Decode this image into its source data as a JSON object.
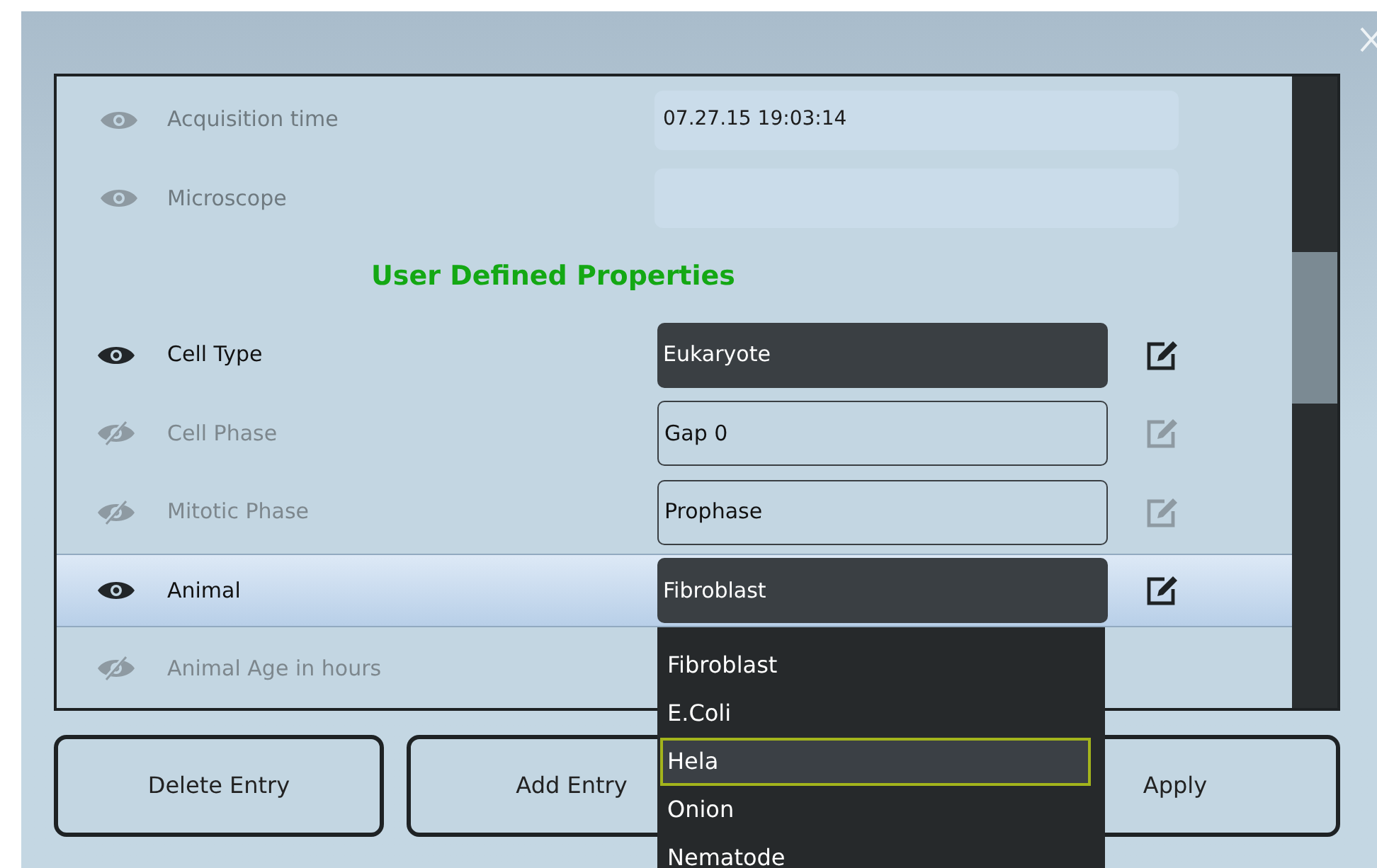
{
  "rows": [
    {
      "kind": "system",
      "label": "Acquisition time",
      "value": "07.27.15 19:03:14"
    },
    {
      "kind": "system",
      "label": "Microscope",
      "value": ""
    },
    {
      "kind": "header",
      "label": "User Defined Properties"
    },
    {
      "kind": "user",
      "label": "Cell Type",
      "value": "Eukaryote",
      "visible": true,
      "selected": false,
      "edit": true
    },
    {
      "kind": "user",
      "label": "Cell Phase",
      "value": "Gap 0",
      "visible": false,
      "selected": false,
      "edit": true
    },
    {
      "kind": "user",
      "label": "Mitotic Phase",
      "value": "Prophase",
      "visible": false,
      "selected": false,
      "edit": true
    },
    {
      "kind": "user",
      "label": "Animal",
      "value": "Fibroblast",
      "visible": true,
      "selected": true,
      "edit": true
    },
    {
      "kind": "user",
      "label": "Animal Age in hours",
      "value": "",
      "visible": false,
      "selected": false,
      "edit": false
    }
  ],
  "buttons": [
    "Delete Entry",
    "Add Entry",
    "Apply"
  ],
  "dropdown": [
    {
      "label": "Fibroblast",
      "selected": false
    },
    {
      "label": "E.Coli",
      "selected": false
    },
    {
      "label": "Hela",
      "selected": true
    },
    {
      "label": "Onion",
      "selected": false
    },
    {
      "label": "Nematode",
      "selected": false
    }
  ]
}
